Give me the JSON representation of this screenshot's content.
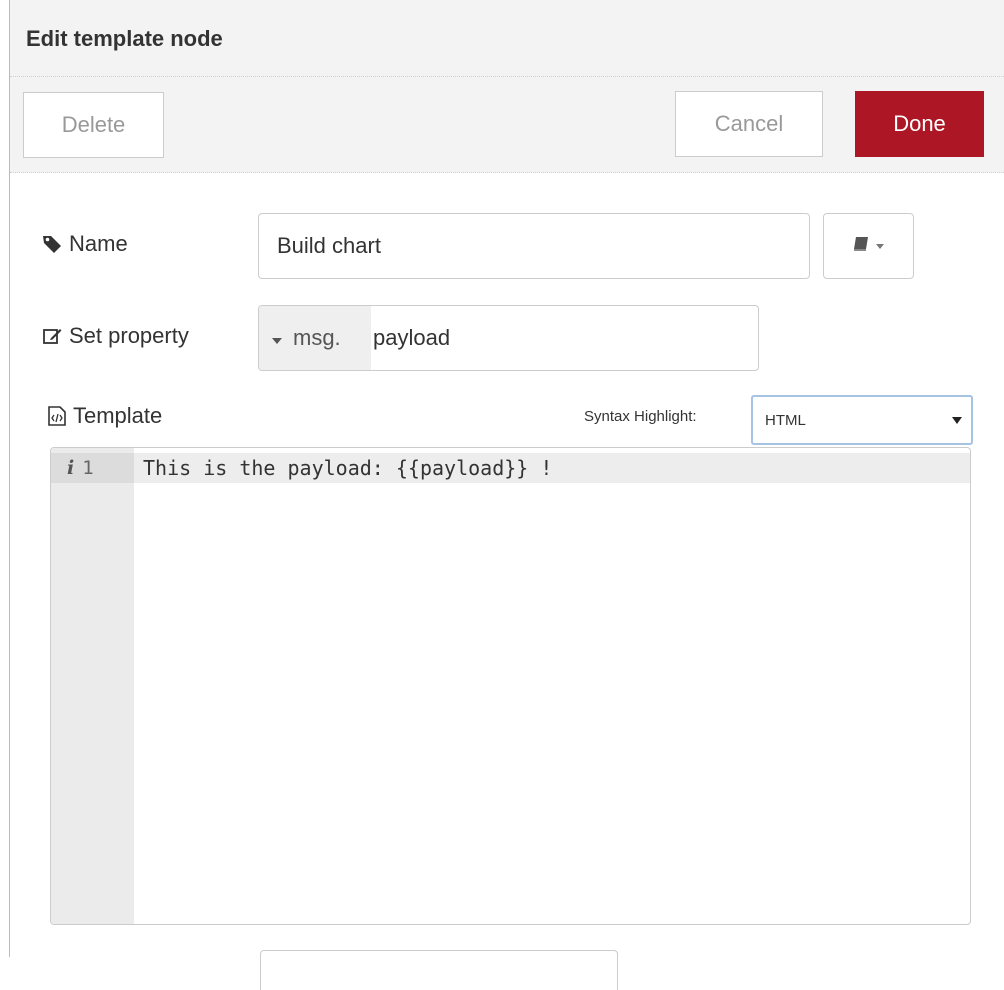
{
  "dialog": {
    "title": "Edit template node"
  },
  "toolbar": {
    "delete_label": "Delete",
    "cancel_label": "Cancel",
    "done_label": "Done"
  },
  "form": {
    "name": {
      "label": "Name",
      "icon": "tag-icon",
      "value": "Build chart",
      "library_icon": "book-icon"
    },
    "property": {
      "label": "Set property",
      "icon": "edit-icon",
      "type": "msg.",
      "value": "payload"
    },
    "template": {
      "label": "Template",
      "icon": "file-code-icon",
      "syntax_label": "Syntax Highlight:",
      "syntax_value": "HTML",
      "lines": [
        {
          "number": "1",
          "marker": "i",
          "text": "This is the payload: {{payload}} !"
        }
      ]
    }
  },
  "colors": {
    "done_button": "#ad1625",
    "header_background": "#f3f3f3",
    "select_focus_border": "#a5c3e3"
  }
}
